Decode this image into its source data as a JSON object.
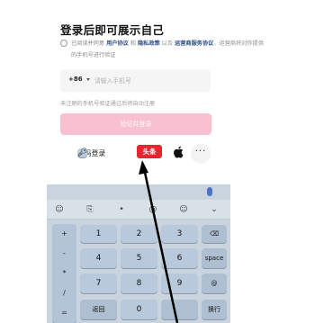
{
  "header": {
    "title": "登录后即可展示自己"
  },
  "agreement": {
    "prefix": "已阅读并同意 ",
    "user_agreement": "用户协议",
    "conj1": " 和 ",
    "privacy_policy": "隐私政策",
    "conj2": " 以及 ",
    "operator_service": "运营商服务协议",
    "suffix": "，运营商将对你提供的手机号进行验证"
  },
  "phone": {
    "country_code": "+86",
    "placeholder": "请输入手机号",
    "value": ""
  },
  "hint": "未注册的手机号验证通过后将自动注册",
  "primary_button": "验证并登录",
  "alt_login": {
    "password_login": "密码登录",
    "toutiao_label": "头条",
    "apple_icon": "apple-icon",
    "more_label": "···"
  },
  "colors": {
    "primary_disabled": "#f9c1cf",
    "link": "#2d4f8e",
    "toutiao_red": "#e8252e",
    "keyboard_bg": "#cad4de"
  },
  "keyboard": {
    "tools": [
      "emoji-icon",
      "clipboard-icon",
      "mic-icon",
      "smiley-icon",
      "collapse-icon"
    ],
    "symbols": [
      "+",
      "-",
      "*",
      "/",
      "="
    ],
    "digits": [
      "1",
      "2",
      "3",
      "4",
      "5",
      "6",
      "7",
      "8",
      "9",
      "0"
    ],
    "backspace_icon": "backspace-icon",
    "space": "space",
    "at": "@",
    "back": "返回",
    "enter": "换行"
  }
}
